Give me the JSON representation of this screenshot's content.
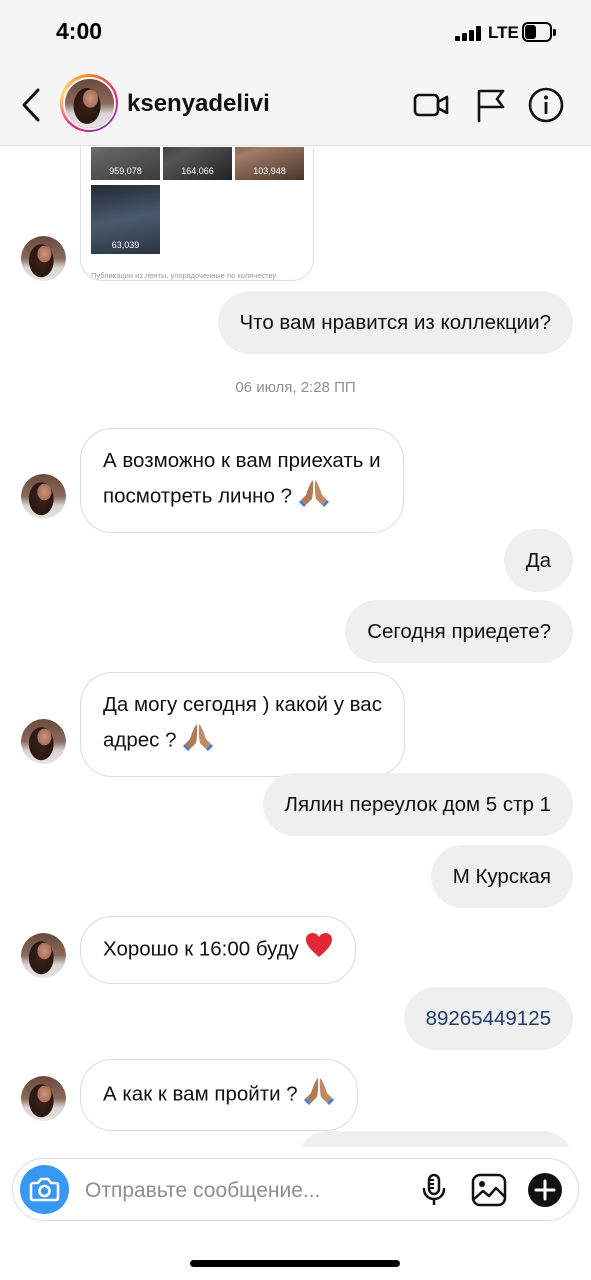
{
  "status_bar": {
    "time": "4:00",
    "network": "LTE",
    "battery_level": 0.45
  },
  "header": {
    "username": "ksenyadelivi",
    "icons": [
      "back-chevron-icon",
      "video-call-icon",
      "flag-icon",
      "info-icon"
    ]
  },
  "media_card": {
    "counts": [
      "959,078",
      "164,066",
      "103,948",
      "63,039"
    ],
    "caption": "Публикации из ленты, упорядоченные по количеству"
  },
  "messages": [
    {
      "from": "me",
      "text": "Что вам нравится из коллекции?"
    },
    {
      "type": "timestamp",
      "text": "06 июля, 2:28 ПП"
    },
    {
      "from": "them",
      "line1": "А возможно к вам приехать и",
      "line2": "посмотреть лично ?"
    },
    {
      "from": "me",
      "text": "Да"
    },
    {
      "from": "me",
      "text": "Сегодня приедете?"
    },
    {
      "from": "them",
      "line1": "Да могу сегодня ) какой у вас",
      "line2": "адрес ?"
    },
    {
      "from": "me",
      "text": "Лялин переулок дом 5 стр 1"
    },
    {
      "from": "me",
      "text": "М Курская"
    },
    {
      "from": "them",
      "text": "Хорошо к 16:00 буду"
    },
    {
      "from": "me",
      "text": "89265449125"
    },
    {
      "from": "them",
      "text": "А как к вам пройти ?"
    }
  ],
  "composer": {
    "placeholder": "Отправьте сообщение...",
    "icons": [
      "camera-icon",
      "microphone-icon",
      "gallery-icon",
      "add-icon"
    ]
  },
  "colors": {
    "accent": "#3897f0",
    "link": "#1f3b6b",
    "outgoing_bubble": "#efefef"
  }
}
